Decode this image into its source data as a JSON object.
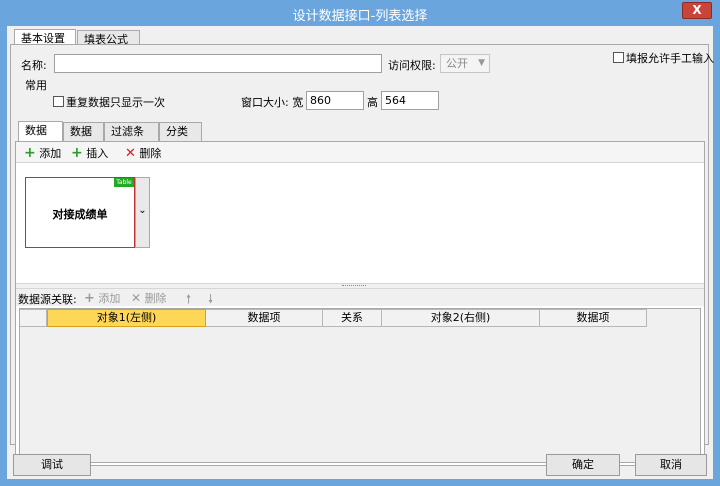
{
  "window": {
    "title": "设计数据接口-列表选择",
    "close_label": "X"
  },
  "tabs_top": [
    "基本设置",
    "填表公式"
  ],
  "form": {
    "name_label": "名称:",
    "name_value": "",
    "access_label": "访问权限:",
    "access_value": "公开",
    "allow_manual_label": "填报允许手工输入",
    "common_group": "常用",
    "dup_only_once_label": "重复数据只显示一次",
    "window_size_label": "窗口大小: 宽",
    "width_value": "860",
    "height_label": "高",
    "height_value": "564"
  },
  "tabs_inner": [
    "数据源",
    "数据列",
    "过滤条件",
    "分类树"
  ],
  "toolbar": {
    "add": "添加",
    "insert": "插入",
    "delete": "删除"
  },
  "datasource": {
    "tag": "Table",
    "name": "对接成绩单"
  },
  "relations": {
    "label": "数据源关联:",
    "add": "添加",
    "delete": "删除",
    "up_icon": "arrow-up-icon",
    "down_icon": "arrow-down-icon",
    "columns": [
      "对象1(左侧)",
      "数据项",
      "关系",
      "对象2(右侧)",
      "数据项"
    ]
  },
  "buttons": {
    "debug": "调试",
    "ok": "确定",
    "cancel": "取消"
  },
  "colors": {
    "title_bar": "#6aa6dd",
    "close": "#c9453a",
    "selected_header": "#ffd757"
  }
}
